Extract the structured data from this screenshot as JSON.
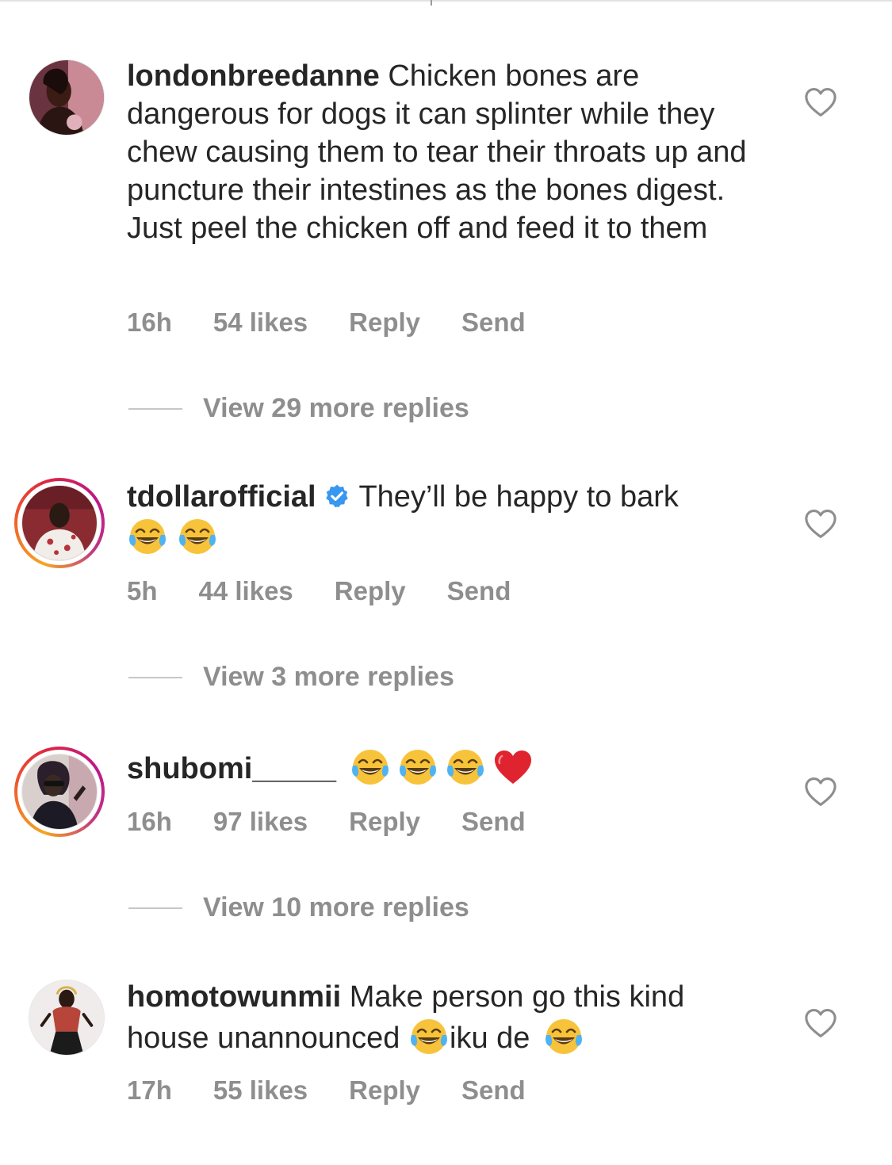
{
  "comments": [
    {
      "username": "londonbreedanne",
      "verified": false,
      "text": "Chicken bones are dangerous for dogs it can splinter while they chew causing them to tear their throats up and puncture their intestines as the bones digest. Just peel the chicken off and feed it to them",
      "time": "16h",
      "likes": "54 likes",
      "reply_label": "Reply",
      "send_label": "Send",
      "view_replies": "View 29 more replies",
      "has_story_ring": false,
      "liked": false
    },
    {
      "username": "tdollarofficial",
      "verified": true,
      "text": "They’ll be happy to bark",
      "trailing_emojis": [
        "face-with-tears-of-joy",
        "face-with-tears-of-joy"
      ],
      "time": "5h",
      "likes": "44 likes",
      "reply_label": "Reply",
      "send_label": "Send",
      "view_replies": "View 3 more replies",
      "has_story_ring": true,
      "liked": false
    },
    {
      "username": "shubomi_____",
      "verified": false,
      "text": "",
      "trailing_emojis": [
        "face-with-tears-of-joy",
        "face-with-tears-of-joy",
        "face-with-tears-of-joy",
        "red-heart"
      ],
      "time": "16h",
      "likes": "97 likes",
      "reply_label": "Reply",
      "send_label": "Send",
      "view_replies": "View 10 more replies",
      "has_story_ring": true,
      "liked": false
    },
    {
      "username": "homotowunmii",
      "verified": false,
      "text_part1": "Make person go this kind house unannounced",
      "text_part2": "iku de",
      "inline_emojis": [
        "face-with-tears-of-joy",
        "face-with-tears-of-joy"
      ],
      "time": "17h",
      "likes": "55 likes",
      "reply_label": "Reply",
      "send_label": "Send",
      "has_story_ring": false,
      "liked": false
    }
  ],
  "colors": {
    "text": "#262626",
    "meta": "#8e8e8e",
    "verified_badge": "#3897f0",
    "story_ring_start": "#f5a623",
    "story_ring_end": "#bc1888"
  }
}
